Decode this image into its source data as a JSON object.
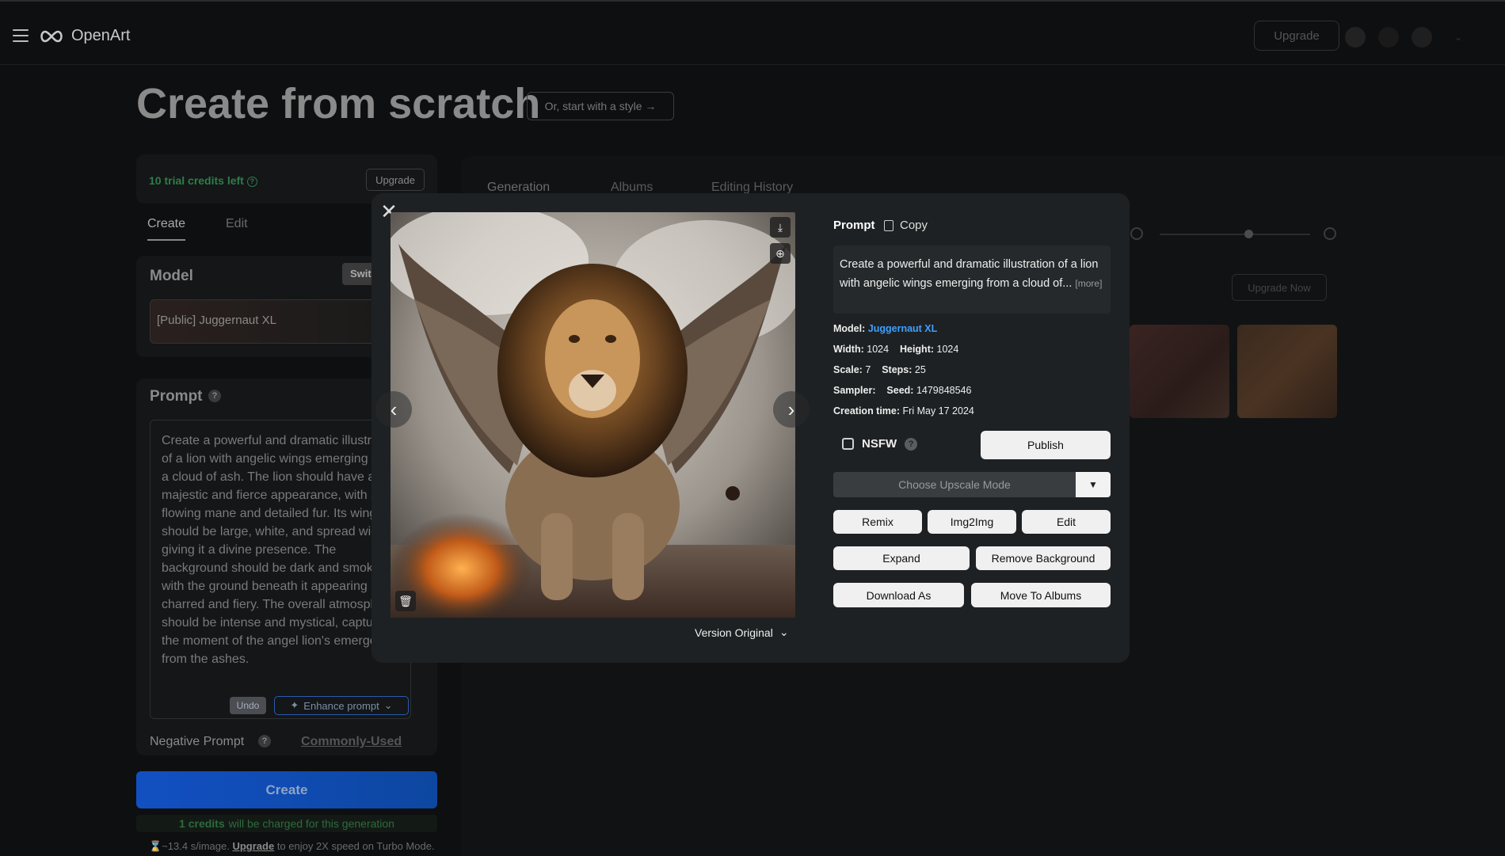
{
  "app": {
    "name": "OpenArt"
  },
  "topbar": {
    "upgrade_label": "Upgrade"
  },
  "page": {
    "title": "Create from scratch",
    "style_button": "Or, start with a style →"
  },
  "credits": {
    "text": "10 trial credits left",
    "upgrade_label": "Upgrade"
  },
  "left_tabs": [
    {
      "label": "Create"
    },
    {
      "label": "Edit"
    }
  ],
  "model_card": {
    "title": "Model",
    "switch_label": "Swit",
    "model_value": "[Public] Juggernaut XL"
  },
  "prompt_card": {
    "title": "Prompt",
    "text": "Create a powerful and dramatic illustration of a lion with angelic wings emerging from a cloud of ash. The lion should have a majestic and fierce appearance, with a flowing mane and detailed fur. Its wings should be large, white, and spread wide, giving it a divine presence. The background should be dark and smoky, with the ground beneath it appearing charred and fiery. The overall atmosphere should be intense and mystical, capturing the moment of the angel lion's emergence from the ashes.",
    "undo_label": "Undo",
    "enhance_label": "Enhance prompt",
    "negative_label": "Negative Prompt",
    "commonly_used_label": "Commonly-Used"
  },
  "create_button": {
    "label": "Create"
  },
  "charge": {
    "credits": "1 credits",
    "rest": "will be charged for this generation"
  },
  "turbo": {
    "prefix": "~13.4 s/image.",
    "link": "Upgrade",
    "suffix": "to enjoy 2X speed on Turbo Mode."
  },
  "right_tabs": [
    {
      "label": "Generation"
    },
    {
      "label": "Albums"
    },
    {
      "label": "Editing History"
    }
  ],
  "right_panel": {
    "upgrade_now": "Upgrade Now"
  },
  "modal": {
    "version_label": "Version Original",
    "prompt_label": "Prompt",
    "copy_label": "Copy",
    "prompt_text": "Create a powerful and dramatic illustration of a lion with angelic wings emerging from a cloud of...",
    "more_label": "[more]",
    "model_label": "Model:",
    "model_value": "Juggernaut XL",
    "width_label": "Width:",
    "width_value": "1024",
    "height_label": "Height:",
    "height_value": "1024",
    "scale_label": "Scale:",
    "scale_value": "7",
    "steps_label": "Steps:",
    "steps_value": "25",
    "sampler_label": "Sampler:",
    "seed_label": "Seed:",
    "seed_value": "1479848546",
    "creation_label": "Creation time:",
    "creation_value": "Fri May 17 2024",
    "nsfw_label": "NSFW",
    "publish_label": "Publish",
    "upscale_label": "Choose Upscale Mode",
    "buttons_row1": [
      "Remix",
      "Img2Img",
      "Edit"
    ],
    "buttons_row2": [
      "Expand",
      "Remove Background"
    ],
    "buttons_row3": [
      "Download As",
      "Move To Albums"
    ]
  },
  "colors": {
    "accent_blue": "#3ea0ff",
    "create_blue": "#1250c2",
    "credit_green": "#2e7d4a"
  }
}
